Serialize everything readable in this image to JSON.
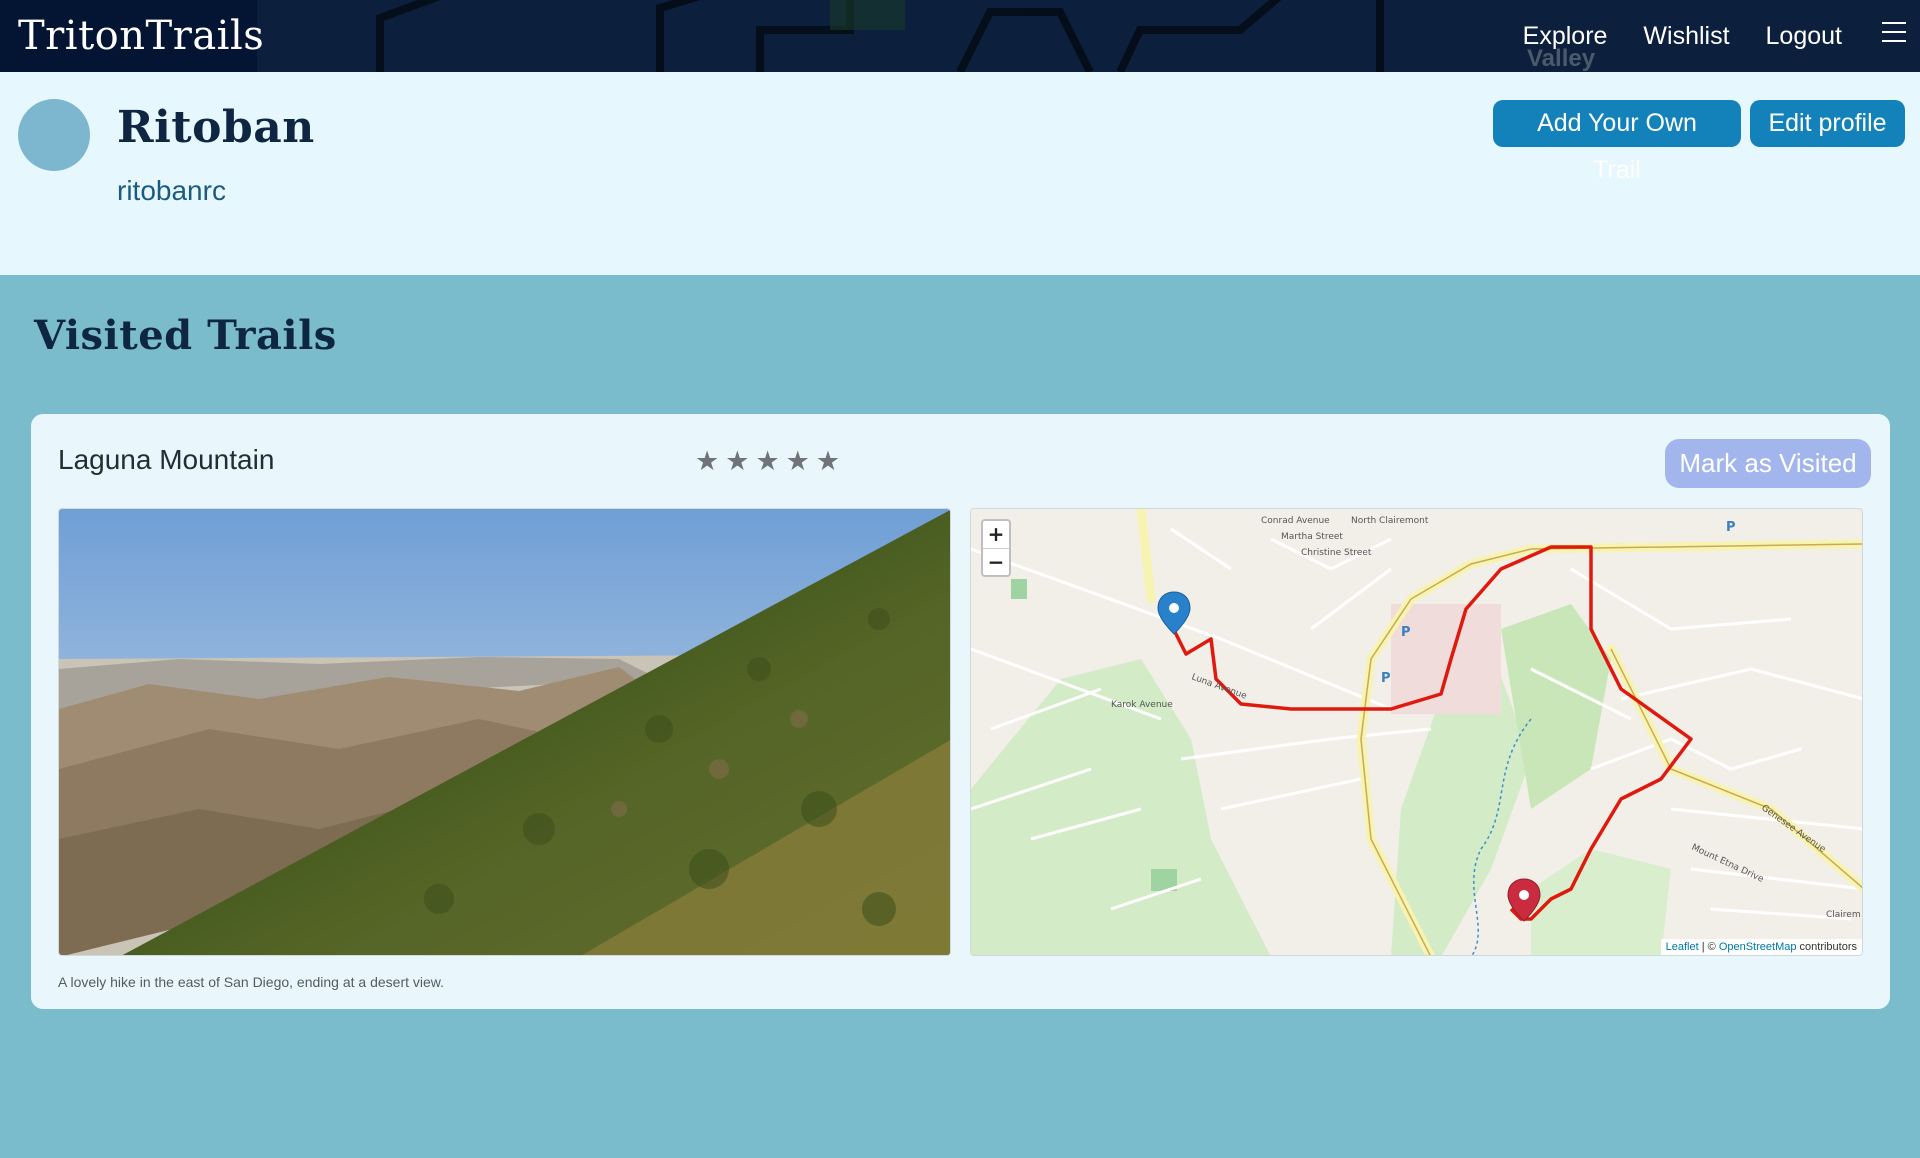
{
  "navbar": {
    "brand": "TritonTrails",
    "links": [
      "Explore",
      "Wishlist",
      "Logout"
    ],
    "menu_icon": "hamburger-icon",
    "background_watermark": "Valley"
  },
  "profile": {
    "name": "Ritoban",
    "username": "ritobanrc",
    "add_trail_label": "Add Your Own Trail",
    "edit_profile_label": "Edit profile"
  },
  "section": {
    "title": "Visited Trails"
  },
  "trail": {
    "name": "Laguna Mountain",
    "rating_stars": "5",
    "star_glyph": "★",
    "mark_visited_label": "Mark as Visited",
    "description": "A lovely hike in the east of San Diego, ending at a desert view."
  },
  "map": {
    "zoom_in": "+",
    "zoom_out": "−",
    "attribution": {
      "leaflet": "Leaflet",
      "separator": " | © ",
      "osm": "OpenStreetMap",
      "contributors": " contributors"
    },
    "street_labels": [
      "North Clairemont",
      "Conrad Avenue",
      "Martha Street",
      "Christine Street",
      "Genesee Avenue",
      "Karok Avenue",
      "Luna Avenue",
      "Mount Etna Drive",
      "Clairem"
    ],
    "route_color": "#e0190f",
    "start_marker_color": "#2a81cb",
    "end_marker_color": "#cb2b3e"
  },
  "colors": {
    "navbar": "#0c1f3d",
    "profile_bg": "#e7f7fe",
    "page_bg": "#7bbccc",
    "button_primary": "#1482ba",
    "button_disabled": "#a2b5ec"
  }
}
